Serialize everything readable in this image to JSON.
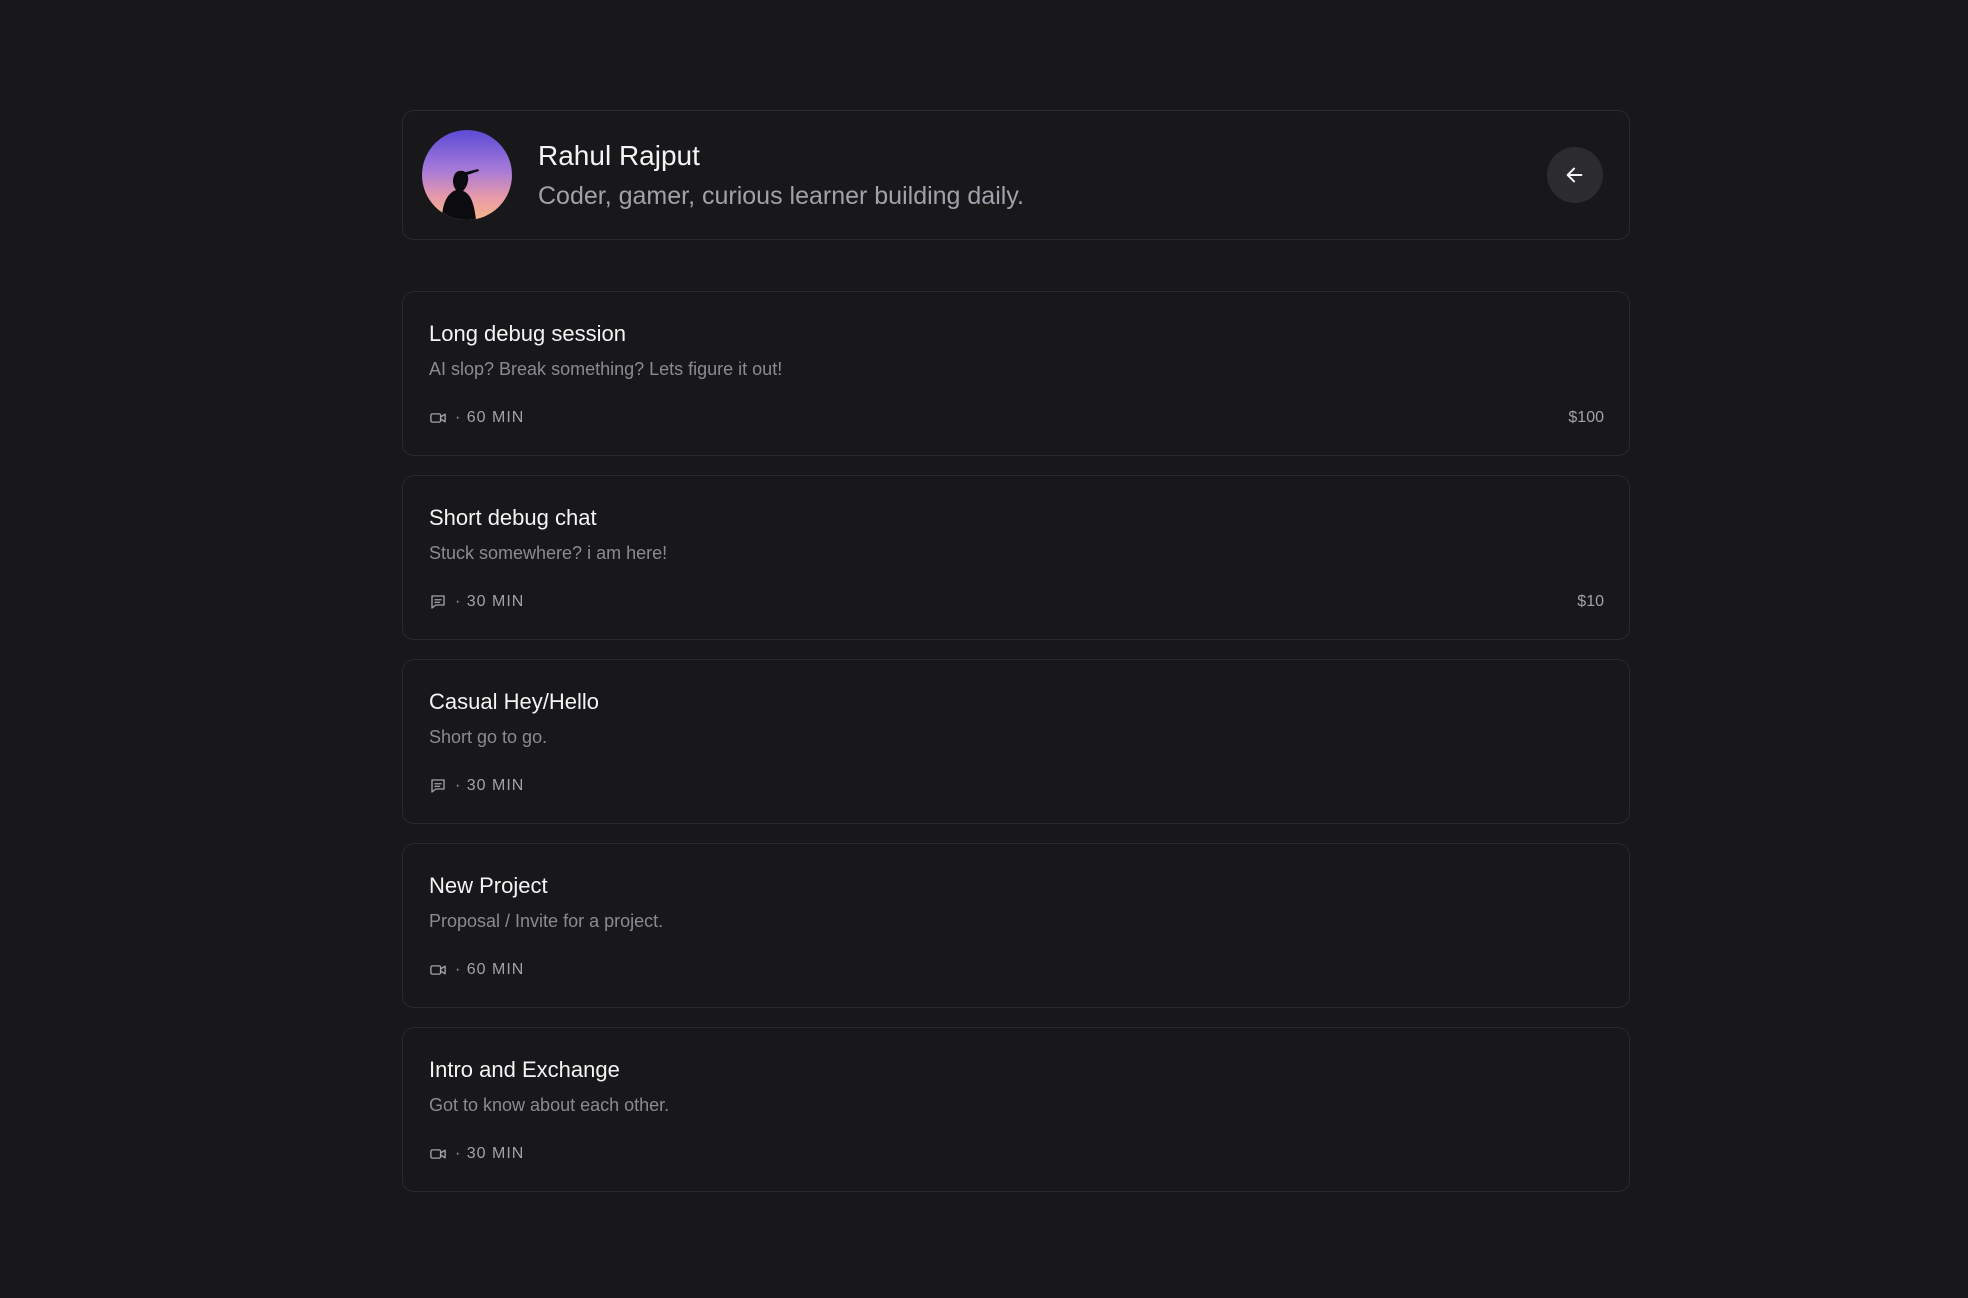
{
  "profile": {
    "name": "Rahul Rajput",
    "bio": "Coder, gamer, curious learner building daily."
  },
  "events": [
    {
      "title": "Long debug session",
      "description": "AI slop? Break something? Lets figure it out!",
      "icon": "video-icon",
      "duration": "· 60 MIN",
      "price": "$100"
    },
    {
      "title": "Short debug chat",
      "description": "Stuck somewhere? i am here!",
      "icon": "chat-icon",
      "duration": "· 30 MIN",
      "price": "$10"
    },
    {
      "title": "Casual Hey/Hello",
      "description": "Short go to go.",
      "icon": "chat-icon",
      "duration": "· 30 MIN",
      "price": ""
    },
    {
      "title": "New Project",
      "description": "Proposal / Invite for a project.",
      "icon": "video-icon",
      "duration": "· 60 MIN",
      "price": ""
    },
    {
      "title": "Intro and Exchange",
      "description": "Got to know about each other.",
      "icon": "video-icon",
      "duration": "· 30 MIN",
      "price": ""
    }
  ]
}
